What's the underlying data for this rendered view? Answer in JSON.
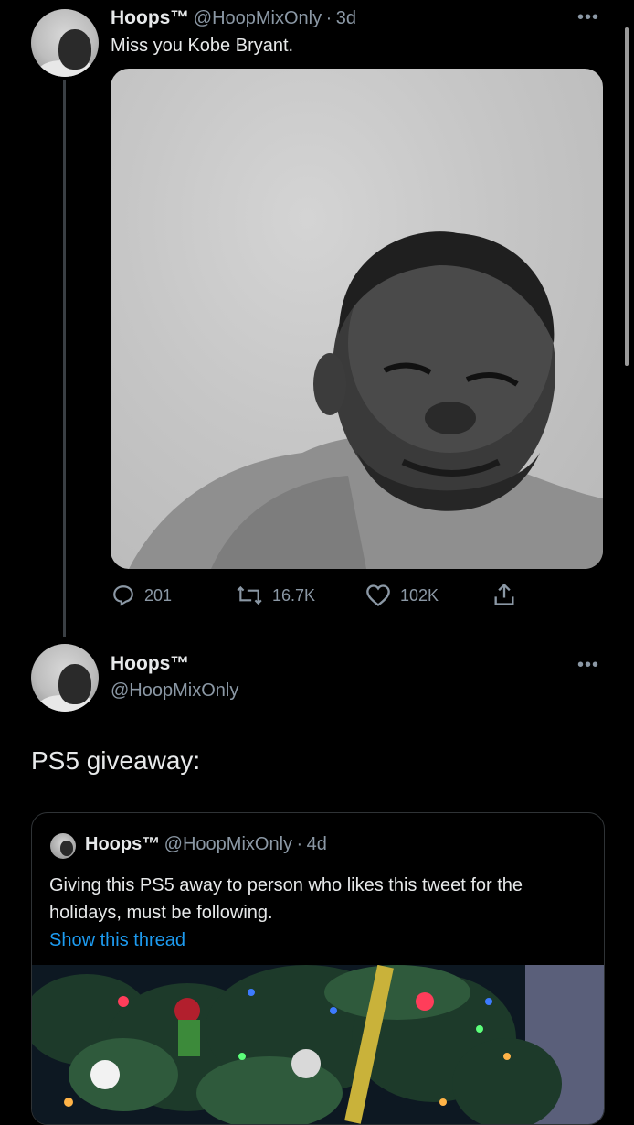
{
  "tweet1": {
    "display_name": "Hoops™",
    "handle": "@HoopMixOnly",
    "separator": "·",
    "time": "3d",
    "text": "Miss you Kobe Bryant.",
    "more": "•••",
    "actions": {
      "replies": "201",
      "retweets": "16.7K",
      "likes": "102K"
    },
    "icons": [
      "reply-icon",
      "retweet-icon",
      "like-icon",
      "share-icon"
    ]
  },
  "tweet2": {
    "display_name": "Hoops™",
    "handle": "@HoopMixOnly",
    "more": "•••",
    "text": "PS5 giveaway:",
    "quote": {
      "display_name": "Hoops™",
      "handle": "@HoopMixOnly",
      "separator": "·",
      "time": "4d",
      "text": "Giving this PS5 away to person who likes this tweet for the holidays, must be following.",
      "show_thread": "Show this thread"
    }
  },
  "colors": {
    "background": "#000000",
    "text": "#e7e9ea",
    "muted": "#8b98a5",
    "link": "#1d9bf0"
  }
}
